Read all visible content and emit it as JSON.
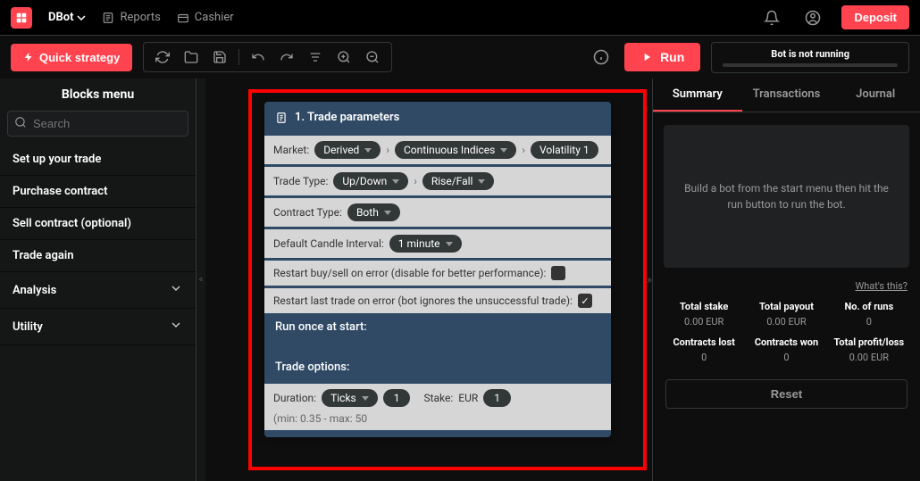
{
  "nav": {
    "brand": "DBot",
    "links": [
      {
        "label": "Reports"
      },
      {
        "label": "Cashier"
      }
    ],
    "deposit": "Deposit"
  },
  "toolbar": {
    "quick_strategy": "Quick strategy",
    "run": "Run",
    "status": "Bot is not running"
  },
  "sidebar": {
    "title": "Blocks menu",
    "search_placeholder": "Search",
    "items": [
      {
        "label": "Set up your trade",
        "expandable": false
      },
      {
        "label": "Purchase contract",
        "expandable": false
      },
      {
        "label": "Sell contract (optional)",
        "expandable": false
      },
      {
        "label": "Trade again",
        "expandable": false
      },
      {
        "label": "Analysis",
        "expandable": true
      },
      {
        "label": "Utility",
        "expandable": true
      }
    ]
  },
  "block": {
    "title": "1. Trade parameters",
    "rows": {
      "market_label": "Market:",
      "market_derived": "Derived",
      "market_contindices": "Continuous Indices",
      "market_vol": "Volatility 1",
      "tradetype_label": "Trade Type:",
      "tradetype_updown": "Up/Down",
      "tradetype_risefall": "Rise/Fall",
      "contracttype_label": "Contract Type:",
      "contracttype_both": "Both",
      "candle_label": "Default Candle Interval:",
      "candle_value": "1 minute",
      "restart_buysell": "Restart buy/sell on error (disable for better performance):",
      "restart_last": "Restart last trade on error (bot ignores the unsuccessful trade):"
    },
    "run_once": "Run once at start:",
    "trade_options": "Trade options:",
    "duration_label": "Duration:",
    "duration_unit": "Ticks",
    "duration_value": "1",
    "stake_label": "Stake:",
    "stake_currency": "EUR",
    "stake_value": "1",
    "stake_range": "(min: 0.35 - max: 50"
  },
  "right": {
    "tabs": [
      "Summary",
      "Transactions",
      "Journal"
    ],
    "info": "Build a bot from the start menu then hit the run button to run the bot.",
    "whats_this": "What's this?",
    "stats": [
      {
        "label": "Total stake",
        "value": "0.00 EUR"
      },
      {
        "label": "Total payout",
        "value": "0.00 EUR"
      },
      {
        "label": "No. of runs",
        "value": "0"
      },
      {
        "label": "Contracts lost",
        "value": "0"
      },
      {
        "label": "Contracts won",
        "value": "0"
      },
      {
        "label": "Total profit/loss",
        "value": "0.00 EUR"
      }
    ],
    "reset": "Reset"
  }
}
